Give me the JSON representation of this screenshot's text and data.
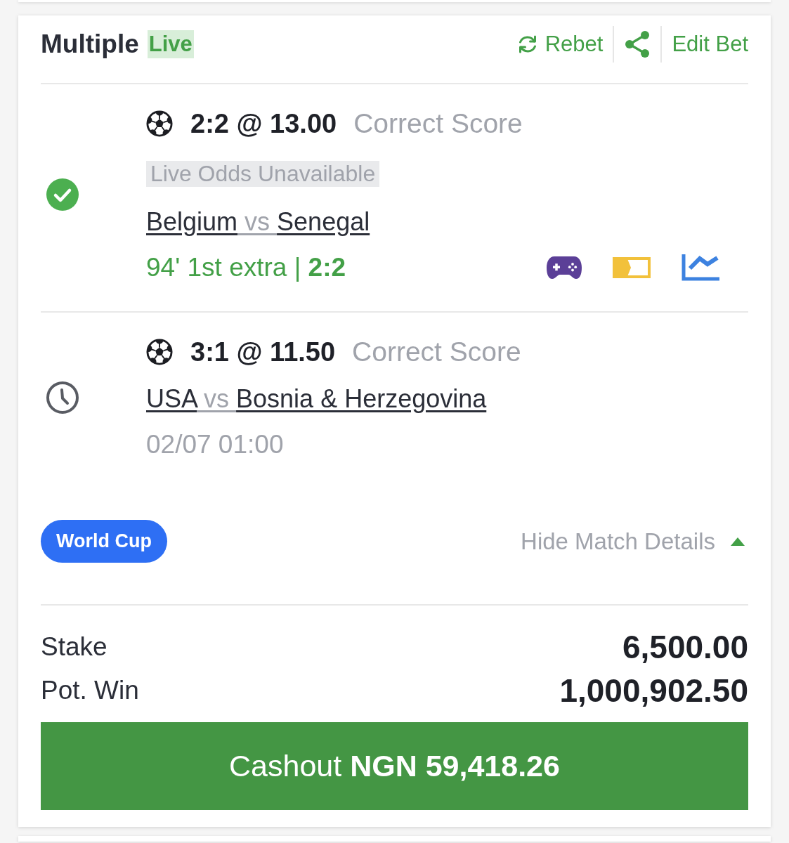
{
  "bet": {
    "title": "Multiple",
    "badge": "Live",
    "actions": [
      {
        "kind": "rebet",
        "label": "Rebet"
      },
      {
        "kind": "share"
      },
      {
        "kind": "edit",
        "label": "Edit Bet"
      }
    ]
  },
  "legs": [
    {
      "kind": "live",
      "pick": "2:2 @ 13.00",
      "market": "Correct Score",
      "notice": "Live Odds Unavailable",
      "teams": {
        "home": "Belgium",
        "separator": "vs",
        "away": "Senegal"
      },
      "info": "94' 1st extra | **2:2**"
    },
    {
      "kind": "scheduled",
      "pick": "3:1 @ 11.50",
      "market": "Correct Score",
      "teams": {
        "home": "USA",
        "separator": "vs",
        "away": "Bosnia & Herzegovina"
      },
      "info": "02/07 01:00"
    }
  ],
  "tag": "World Cup",
  "details_toggle": {
    "label": "Hide Match Details",
    "expanded": true
  },
  "summary": [
    {
      "label": "Stake",
      "value": "6,500.00"
    },
    {
      "label": "Pot. Win",
      "value": "1,000,902.50"
    }
  ],
  "cashout": {
    "label": "Cashout **NGN 59,418.26**"
  }
}
